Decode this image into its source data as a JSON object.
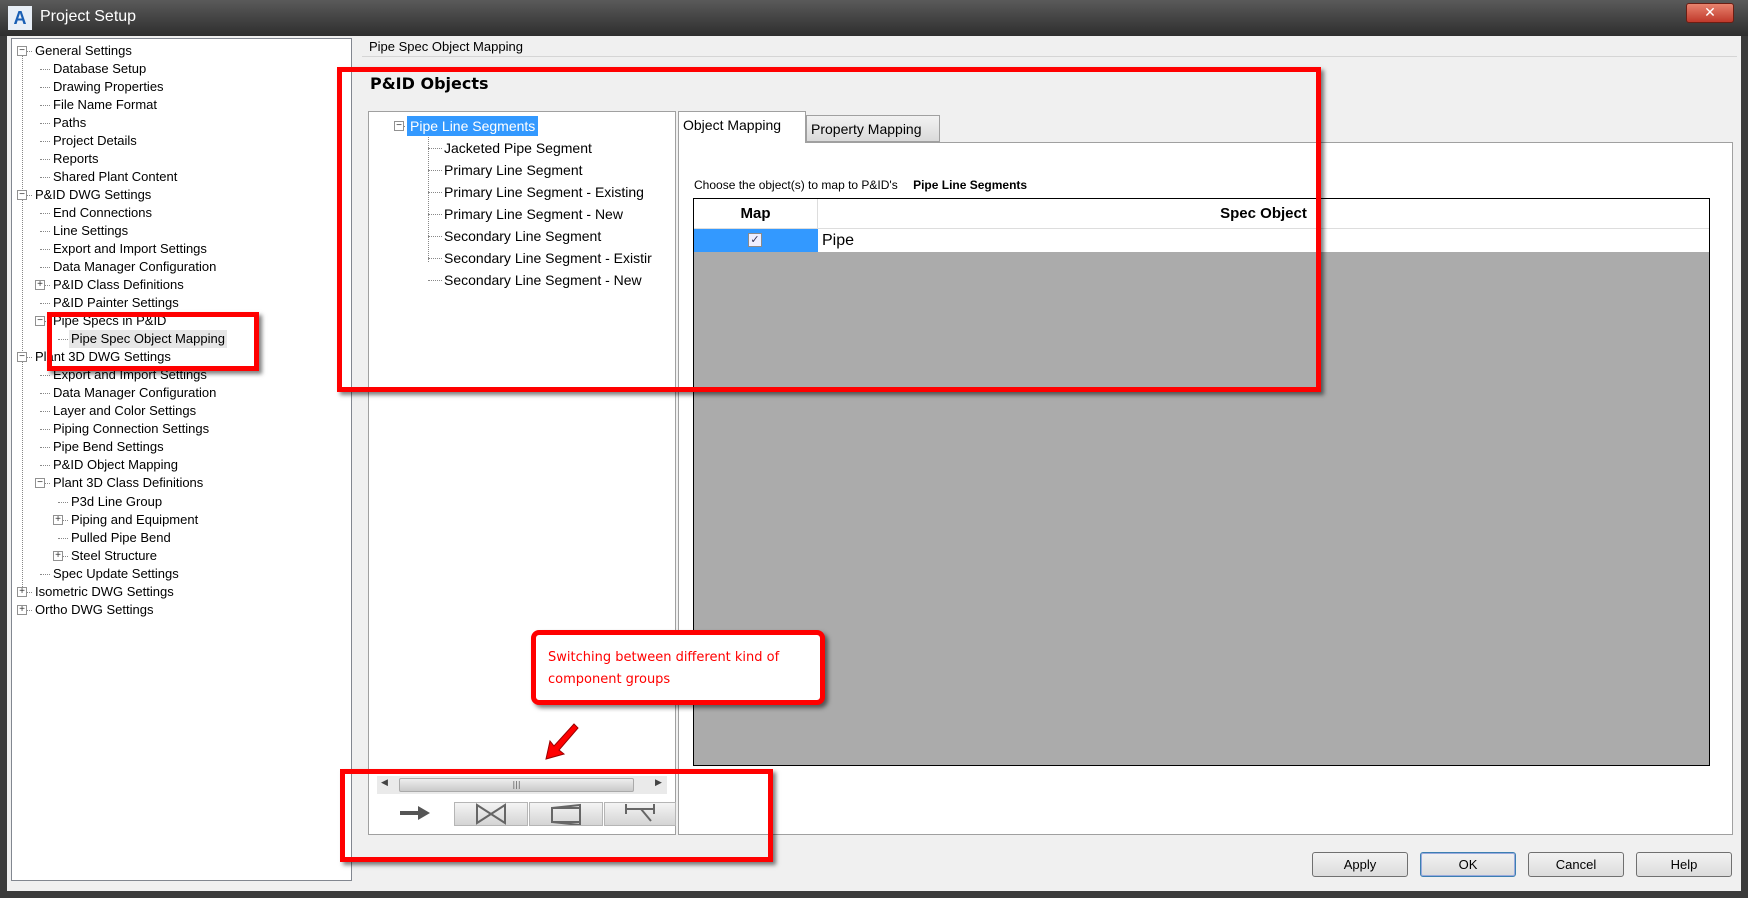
{
  "window": {
    "title": "Project Setup",
    "app_icon": "A",
    "close_label": "✕"
  },
  "tree": [
    {
      "label": "General Settings",
      "level": 0,
      "exp": "-"
    },
    {
      "label": "Database Setup",
      "level": 1
    },
    {
      "label": "Drawing Properties",
      "level": 1
    },
    {
      "label": "File Name Format",
      "level": 1
    },
    {
      "label": "Paths",
      "level": 1
    },
    {
      "label": "Project Details",
      "level": 1
    },
    {
      "label": "Reports",
      "level": 1
    },
    {
      "label": "Shared Plant Content",
      "level": 1
    },
    {
      "label": "P&ID DWG Settings",
      "level": 0,
      "exp": "-"
    },
    {
      "label": "End Connections",
      "level": 1
    },
    {
      "label": "Line Settings",
      "level": 1
    },
    {
      "label": "Export and Import Settings",
      "level": 1
    },
    {
      "label": "Data Manager Configuration",
      "level": 1
    },
    {
      "label": "P&ID Class Definitions",
      "level": 1,
      "exp": "+"
    },
    {
      "label": "P&ID Painter Settings",
      "level": 1
    },
    {
      "label": "Pipe Specs in P&ID",
      "level": 1,
      "exp": "-"
    },
    {
      "label": "Pipe Spec Object Mapping",
      "level": 2,
      "selected": true
    },
    {
      "label": "Plant 3D DWG Settings",
      "level": 0,
      "exp": "-"
    },
    {
      "label": "Export and Import Settings",
      "level": 1
    },
    {
      "label": "Data Manager Configuration",
      "level": 1
    },
    {
      "label": "Layer and Color Settings",
      "level": 1
    },
    {
      "label": "Piping Connection Settings",
      "level": 1
    },
    {
      "label": "Pipe Bend Settings",
      "level": 1
    },
    {
      "label": "P&ID Object Mapping",
      "level": 1
    },
    {
      "label": "Plant 3D Class Definitions",
      "level": 1,
      "exp": "-"
    },
    {
      "label": "P3d Line Group",
      "level": 2
    },
    {
      "label": "Piping and Equipment",
      "level": 2,
      "exp": "+"
    },
    {
      "label": "Pulled Pipe Bend",
      "level": 2
    },
    {
      "label": "Steel Structure",
      "level": 2,
      "exp": "+"
    },
    {
      "label": "Spec Update Settings",
      "level": 1
    },
    {
      "label": "Isometric DWG Settings",
      "level": 0,
      "exp": "+"
    },
    {
      "label": "Ortho DWG Settings",
      "level": 0,
      "exp": "+"
    }
  ],
  "main": {
    "header": "Pipe Spec Object Mapping",
    "section_title": "P&ID Objects",
    "objects": [
      {
        "label": "Pipe Line Segments",
        "level": 0,
        "exp": "-",
        "selected": true
      },
      {
        "label": "Jacketed Pipe Segment",
        "level": 1
      },
      {
        "label": "Primary Line Segment",
        "level": 1
      },
      {
        "label": "Primary Line Segment - Existing",
        "level": 1
      },
      {
        "label": "Primary Line Segment - New",
        "level": 1
      },
      {
        "label": "Secondary Line Segment",
        "level": 1
      },
      {
        "label": "Secondary Line Segment - Existir",
        "level": 1
      },
      {
        "label": "Secondary Line Segment - New",
        "level": 1
      }
    ],
    "group_tabs": [
      "arrow-icon",
      "valve-icon",
      "reducer-icon",
      "fitting-icon"
    ],
    "tabs": [
      "Object Mapping",
      "Property Mapping"
    ],
    "choose_text": "Choose the object(s) to map to P&ID's",
    "choose_target": "Pipe Line Segments",
    "grid": {
      "headers": [
        "Map",
        "Spec Object"
      ],
      "rows": [
        {
          "map": true,
          "spec": "Pipe"
        }
      ]
    }
  },
  "buttons": {
    "apply": "Apply",
    "ok": "OK",
    "cancel": "Cancel",
    "help": "Help"
  },
  "annotation": {
    "callout": "Switching between different kind of component groups"
  },
  "colors": {
    "highlight": "#3399ff",
    "annotation": "#ff0000"
  }
}
